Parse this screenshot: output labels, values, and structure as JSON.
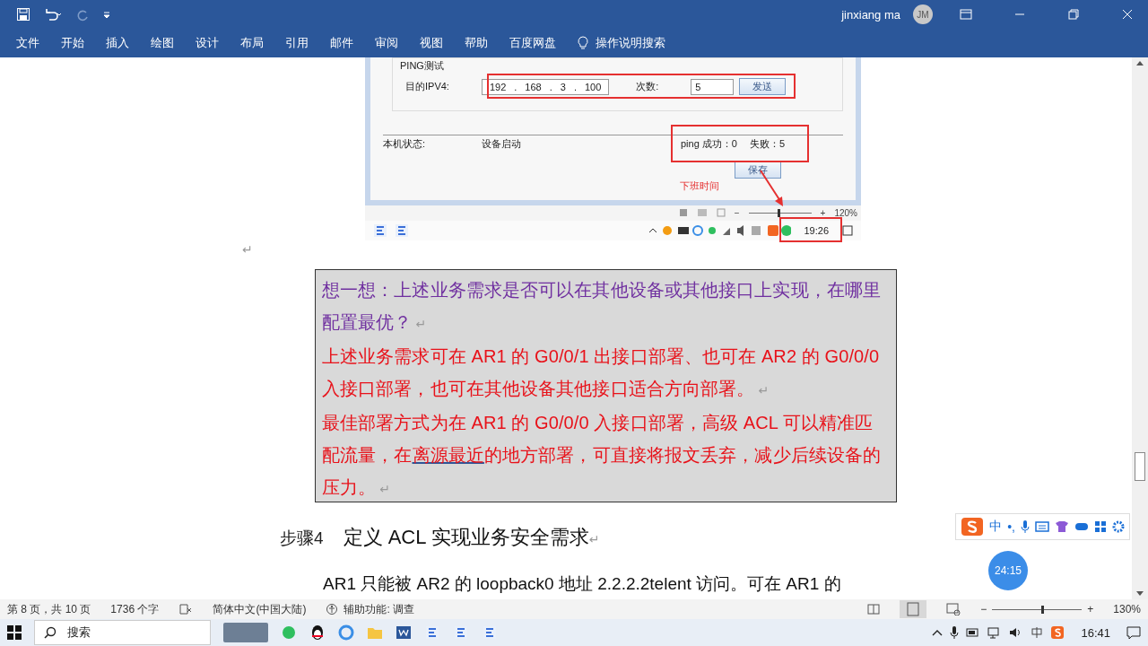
{
  "title_bar": {
    "user_name": "jinxiang ma",
    "avatar_initials": "JM"
  },
  "ribbon_tabs": [
    {
      "label": "文件",
      "selected": false
    },
    {
      "label": "开始",
      "selected": false
    },
    {
      "label": "插入",
      "selected": false
    },
    {
      "label": "绘图",
      "selected": false
    },
    {
      "label": "设计",
      "selected": false
    },
    {
      "label": "布局",
      "selected": false
    },
    {
      "label": "引用",
      "selected": false
    },
    {
      "label": "邮件",
      "selected": false
    },
    {
      "label": "审阅",
      "selected": false
    },
    {
      "label": "视图",
      "selected": false
    },
    {
      "label": "帮助",
      "selected": false
    },
    {
      "label": "百度网盘",
      "selected": false
    }
  ],
  "tell_me": "操作说明搜索",
  "embedded_screenshot": {
    "group_title": "PING测试",
    "ip_label": "目的IPV4:",
    "ip_parts": [
      "192",
      ".",
      "168",
      ".",
      "3",
      ".",
      "100"
    ],
    "count_label": "次数:",
    "count_value": "5",
    "send_button": "发送",
    "status_label": "本机状态:",
    "status_value": "设备启动",
    "ping_success": "ping 成功：0",
    "ping_fail": "失败：5",
    "save_button": "保存",
    "annotation": "下班时间",
    "zoom": {
      "zoom_out": "−",
      "zoom_in": "+",
      "level": 0.47,
      "reading": "120%"
    },
    "clock": "19:26"
  },
  "return_mark": "↵",
  "callout": {
    "paragraphs": [
      {
        "kind": "question",
        "parts": [
          {
            "text": "想一想：上述业务需求是否可以在其他设备或其他接口上实现，在哪里配置最优？",
            "underlined": false
          }
        ],
        "mark": "↵"
      },
      {
        "kind": "answer",
        "parts": [
          {
            "text": "上述业务需求可在 AR1 的 G0/0/1 出接口部署、也可在 AR2 的 G0/0/0 入接口部署，也可在其他设备其他接口适合方向部署。",
            "underlined": false
          }
        ],
        "mark": "↵"
      },
      {
        "kind": "answer",
        "parts": [
          {
            "text": "最佳部署方式为在 AR1 的 G0/0/0 入接口部署，高级 ACL 可以精准匹配流量，在",
            "underlined": false
          },
          {
            "text": "离源最近",
            "underlined": true
          },
          {
            "text": "的地方部署，可直接将报文丢弃，减少后续设备的压力。",
            "underlined": false
          }
        ],
        "mark": "↵"
      }
    ]
  },
  "heading": {
    "step": "步骤4",
    "title": "定义 ACL 实现业务安全需求",
    "mark": "↵"
  },
  "body": "AR1 只能被 AR2 的 loopback0 地址 2.2.2.2telent 访问。可在 AR1 的",
  "ime_toolbar": {
    "labels": [
      "中",
      "•,"
    ]
  },
  "timer": "24:15",
  "status_bar": {
    "page": "第 8 页，共 10 页",
    "words": "1736 个字",
    "language": "简体中文(中国大陆)",
    "accessibility": "辅助功能: 调查",
    "zoom": {
      "zoom_out": "−",
      "zoom_in": "+",
      "level": 0.55,
      "reading": "130%"
    }
  },
  "taskbar": {
    "search_placeholder": "搜索",
    "clock": "16:41"
  }
}
